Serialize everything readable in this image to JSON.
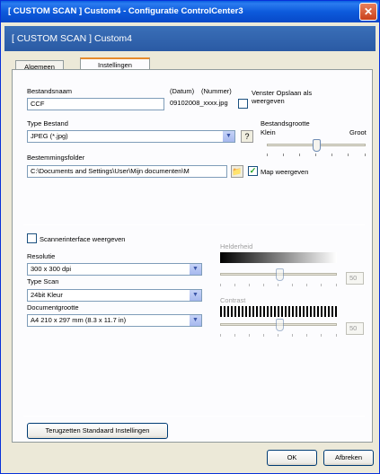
{
  "window": {
    "title": "[ CUSTOM SCAN ]  Custom4 - Configuratie ControlCenter3",
    "close_glyph": "✕"
  },
  "header": {
    "text": "[ CUSTOM SCAN ]  Custom4"
  },
  "tabs": [
    {
      "label": "Algemeen",
      "active": false
    },
    {
      "label": "Instellingen",
      "active": true
    }
  ],
  "file": {
    "name_label": "Bestandsnaam",
    "name_value": "CCF",
    "date_label": "(Datum)",
    "number_label": "(Nummer)",
    "example": "09102008_xxxx.jpg",
    "save_window_label": "Venster Opslaan als weergeven",
    "save_window_checked": false,
    "type_label": "Type Bestand",
    "type_value": "JPEG (*.jpg)",
    "size_label": "Bestandsgrootte",
    "size_small": "Klein",
    "size_large": "Groot",
    "size_level": 0.5,
    "folder_label": "Bestemmingsfolder",
    "folder_value": "C:\\Documents and Settings\\User\\Mijn documenten\\M",
    "show_folder_label": "Map weergeven",
    "show_folder_checked": true,
    "check_glyph": "✓"
  },
  "scan": {
    "interface_label": "Scannerinterface weergeven",
    "interface_checked": false,
    "resolution_label": "Resolutie",
    "resolution_value": "300 x 300 dpi",
    "scan_type_label": "Type Scan",
    "scan_type_value": "24bit Kleur",
    "doc_size_label": "Documentgrootte",
    "doc_size_value": "A4 210 x 297 mm (8.3 x 11.7 in)",
    "brightness_label": "Helderheid",
    "brightness_value": "50",
    "contrast_label": "Contrast",
    "contrast_value": "50"
  },
  "buttons": {
    "reset": "Terugzetten Standaard Instellingen",
    "ok": "OK",
    "cancel": "Afbreken"
  }
}
